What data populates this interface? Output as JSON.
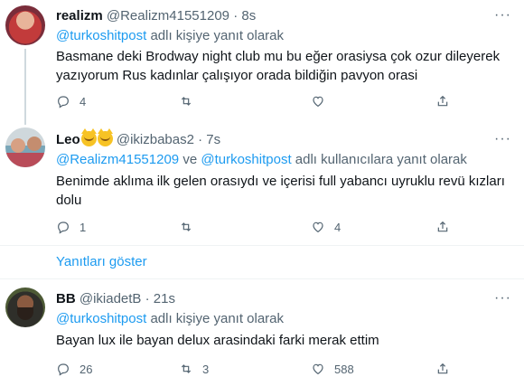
{
  "tweets": [
    {
      "name": "realizm",
      "handle": "@Realizm41551209",
      "separator": "·",
      "time": "8s",
      "reply_prefix": "",
      "reply_mention_1": "@turkoshitpost",
      "reply_conjunction": "",
      "reply_mention_2": "",
      "reply_suffix": " adlı kişiye yanıt olarak",
      "text": "Basmane deki Brodway night club mu bu eğer orasiysa çok ozur dileyerek yazıyorum Rus kadınlar çalışıyor orada bildiğin pavyon orasi",
      "reply_count": "4",
      "retweet_count": "",
      "like_count": ""
    },
    {
      "name": "Leo",
      "handle": "@ikizbabas2",
      "separator": "·",
      "time": "7s",
      "reply_mention_1": "@Realizm41551209",
      "reply_conjunction": " ve ",
      "reply_mention_2": "@turkoshitpost",
      "reply_suffix": " adlı kullanıcılara yanıt olarak",
      "text": "Benimde aklıma ilk gelen orasıydı ve içerisi full yabancı uyruklu revü kızları dolu",
      "reply_count": "1",
      "retweet_count": "",
      "like_count": "4"
    },
    {
      "name": "BB",
      "handle": "@ikiadetB",
      "separator": "·",
      "time": "21s",
      "reply_mention_1": "@turkoshitpost",
      "reply_suffix": " adlı kişiye yanıt olarak",
      "text": "Bayan lux ile bayan delux arasindaki farki merak ettim",
      "reply_count": "26",
      "retweet_count": "3",
      "like_count": "588"
    }
  ],
  "show_replies_label": "Yanıtları göster",
  "more_label": "···",
  "colors": {
    "link": "#1d9bf0",
    "secondary_text": "#536471",
    "primary_text": "#0f1419",
    "emoji": "#f7c325"
  },
  "icons": [
    "reply-icon",
    "retweet-icon",
    "like-icon",
    "share-icon",
    "more-icon",
    "cat-face-emoji"
  ]
}
